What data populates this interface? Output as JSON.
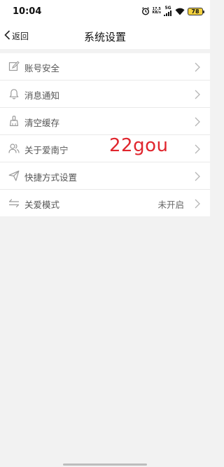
{
  "status_bar": {
    "time": "10:04",
    "network_speed_value": "17.5",
    "network_speed_unit": "KB/s",
    "network_type": "5G",
    "battery": "78"
  },
  "header": {
    "back_label": "返回",
    "title": "系统设置"
  },
  "menu": {
    "items": [
      {
        "label": "账号安全",
        "icon": "edit-icon",
        "value": ""
      },
      {
        "label": "消息通知",
        "icon": "bell-icon",
        "value": ""
      },
      {
        "label": "清空缓存",
        "icon": "broom-icon",
        "value": ""
      },
      {
        "label": "关于爱南宁",
        "icon": "users-icon",
        "value": ""
      },
      {
        "label": "快捷方式设置",
        "icon": "send-icon",
        "value": ""
      },
      {
        "label": "关爱模式",
        "icon": "switch-arrows-icon",
        "value": "未开启"
      }
    ]
  },
  "watermark": {
    "text": "22gou",
    "color": "#e0262e"
  },
  "colors": {
    "background": "#f2f2f2",
    "surface": "#ffffff",
    "divider": "#e9e9e9",
    "icon": "#9a9a9a"
  }
}
